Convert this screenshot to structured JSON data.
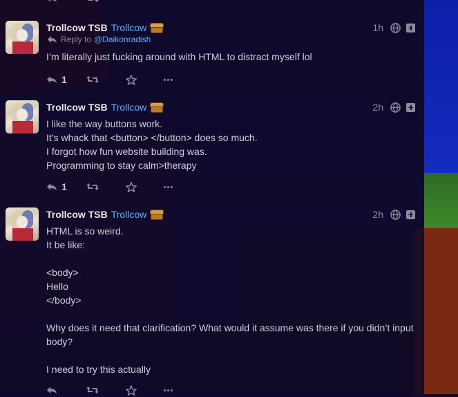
{
  "tweets": [
    {
      "name": "Trollcow TSB",
      "handle": "Trollcow",
      "time": "1h",
      "reply_to_label": "Reply to",
      "reply_to_handle": "@Daikonradish",
      "lines": [
        "I’m literally just fucking around with HTML to distract myself lol"
      ],
      "reply_count": "1"
    },
    {
      "name": "Trollcow TSB",
      "handle": "Trollcow",
      "time": "2h",
      "lines": [
        "I like the way buttons work.",
        "It’s whack that <button> </button> does so much.",
        "I forgot how fun website building was.",
        "Programming to stay calm>therapy"
      ],
      "reply_count": "1"
    },
    {
      "name": "Trollcow TSB",
      "handle": "Trollcow",
      "time": "2h",
      "lines": [
        "HTML is so weird.",
        "It be like:",
        "",
        "<body>",
        "Hello",
        "</body>",
        "",
        "Why does it need that clarification? What would it assume was there if you didn’t input",
        "body?",
        "",
        "I need to try this actually"
      ],
      "reply_count": ""
    }
  ],
  "icons": {
    "reply": "reply-icon",
    "retweet": "retweet-icon",
    "favorite": "star-icon",
    "more": "more-icon",
    "globe": "globe-icon",
    "expand": "plus-box-icon",
    "badge": "treasure-chest-icon"
  },
  "colors": {
    "handle": "#59b4ff",
    "name": "#e8e8e8",
    "muted": "#8a8aa0"
  }
}
